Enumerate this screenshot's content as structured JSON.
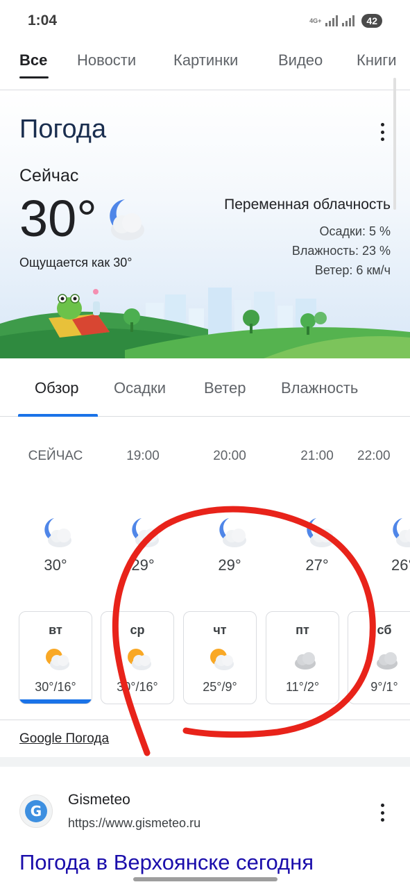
{
  "status_bar": {
    "time": "1:04",
    "network": "4G+",
    "battery": "42"
  },
  "search_tabs": [
    "Все",
    "Новости",
    "Картинки",
    "Видео",
    "Книги"
  ],
  "weather": {
    "title": "Погода",
    "now_label": "Сейчас",
    "temperature": "30°",
    "feels_like": "Ощущается как 30°",
    "condition": "Переменная облачность",
    "precipitation": "Осадки: 5 %",
    "humidity": "Влажность: 23 %",
    "wind": "Ветер: 6 км/ч",
    "condition_icon": "moon-cloud-icon"
  },
  "overview_tabs": [
    "Обзор",
    "Осадки",
    "Ветер",
    "Влажность"
  ],
  "hourly": [
    {
      "time": "СЕЙЧАС",
      "temp": "30°",
      "icon": "moon-cloud-icon"
    },
    {
      "time": "19:00",
      "temp": "29°",
      "icon": "moon-cloud-icon"
    },
    {
      "time": "20:00",
      "temp": "29°",
      "icon": "moon-cloud-icon"
    },
    {
      "time": "21:00",
      "temp": "27°",
      "icon": "moon-cloud-icon"
    },
    {
      "time": "22:00",
      "temp": "26°",
      "icon": "moon-cloud-icon"
    }
  ],
  "daily": [
    {
      "day": "вт",
      "range": "30°/16°",
      "icon": "sun-cloud-icon",
      "selected": true
    },
    {
      "day": "ср",
      "range": "30°/16°",
      "icon": "sun-cloud-icon"
    },
    {
      "day": "чт",
      "range": "25°/9°",
      "icon": "sun-cloud-icon"
    },
    {
      "day": "пт",
      "range": "11°/2°",
      "icon": "cloud-icon"
    },
    {
      "day": "сб",
      "range": "9°/1°",
      "icon": "cloud-icon"
    }
  ],
  "source_link": "Google Погода",
  "result": {
    "site_name": "Gismeteo",
    "url": "https://www.gismeteo.ru",
    "title": "Погода в Верхоянске сегодня"
  },
  "colors": {
    "accent": "#1a73e8",
    "annotation": "#e8231a",
    "title": "#1a2e4f",
    "link": "#1a0dab"
  }
}
